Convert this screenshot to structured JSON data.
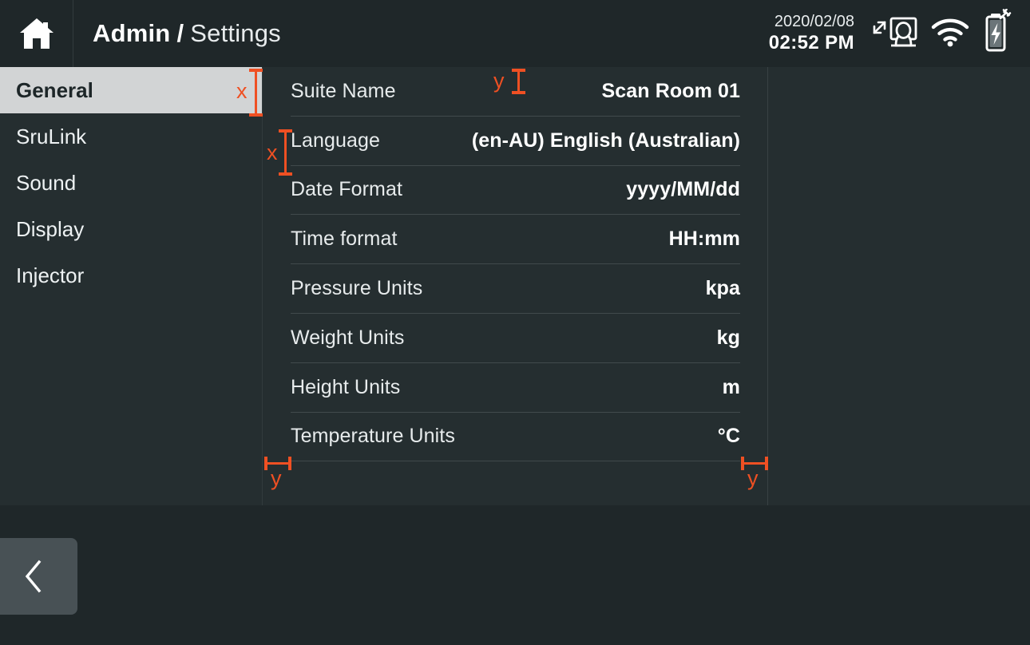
{
  "header": {
    "home_icon": "home-icon",
    "breadcrumb_root": "Admin",
    "breadcrumb_separator": "/",
    "breadcrumb_current": "Settings",
    "date": "2020/02/08",
    "time": "02:52 PM",
    "icons": [
      {
        "name": "patient-table-position-icon"
      },
      {
        "name": "wifi-icon"
      },
      {
        "name": "battery-charging-icon"
      }
    ]
  },
  "sidebar": {
    "items": [
      {
        "label": "General",
        "active": true
      },
      {
        "label": "SruLink",
        "active": false
      },
      {
        "label": "Sound",
        "active": false
      },
      {
        "label": "Display",
        "active": false
      },
      {
        "label": "Injector",
        "active": false
      }
    ]
  },
  "settings": {
    "rows": [
      {
        "label": "Suite Name",
        "value": "Scan Room 01"
      },
      {
        "label": "Language",
        "value": "(en-AU) English (Australian)"
      },
      {
        "label": "Date Format",
        "value": "yyyy/MM/dd"
      },
      {
        "label": "Time format",
        "value": "HH:mm"
      },
      {
        "label": "Pressure Units",
        "value": "kpa"
      },
      {
        "label": "Weight Units",
        "value": "kg"
      },
      {
        "label": "Height Units",
        "value": "m"
      },
      {
        "label": "Temperature Units",
        "value": "°C"
      }
    ]
  },
  "footer": {
    "back_label": "‹",
    "back_icon": "chevron-left-icon"
  },
  "annotations": {
    "accent_color": "#ef5023",
    "markers": [
      {
        "letter": "x",
        "orientation": "vertical",
        "target": "sidebar-item-general-height"
      },
      {
        "letter": "x",
        "orientation": "vertical",
        "target": "settings-row-language-height"
      },
      {
        "letter": "y",
        "orientation": "vertical",
        "target": "settings-panel-top-gap"
      },
      {
        "letter": "y",
        "orientation": "horizontal",
        "target": "settings-panel-left-padding"
      },
      {
        "letter": "y",
        "orientation": "horizontal",
        "target": "settings-panel-right-padding"
      }
    ]
  },
  "colors": {
    "background": "#1f2729",
    "panel": "#252e30",
    "selected_item": "#d2d4d5",
    "selected_item_text": "#1d2628",
    "divider": "#414a4c",
    "accent": "#ef5023",
    "back_button": "#485155"
  }
}
